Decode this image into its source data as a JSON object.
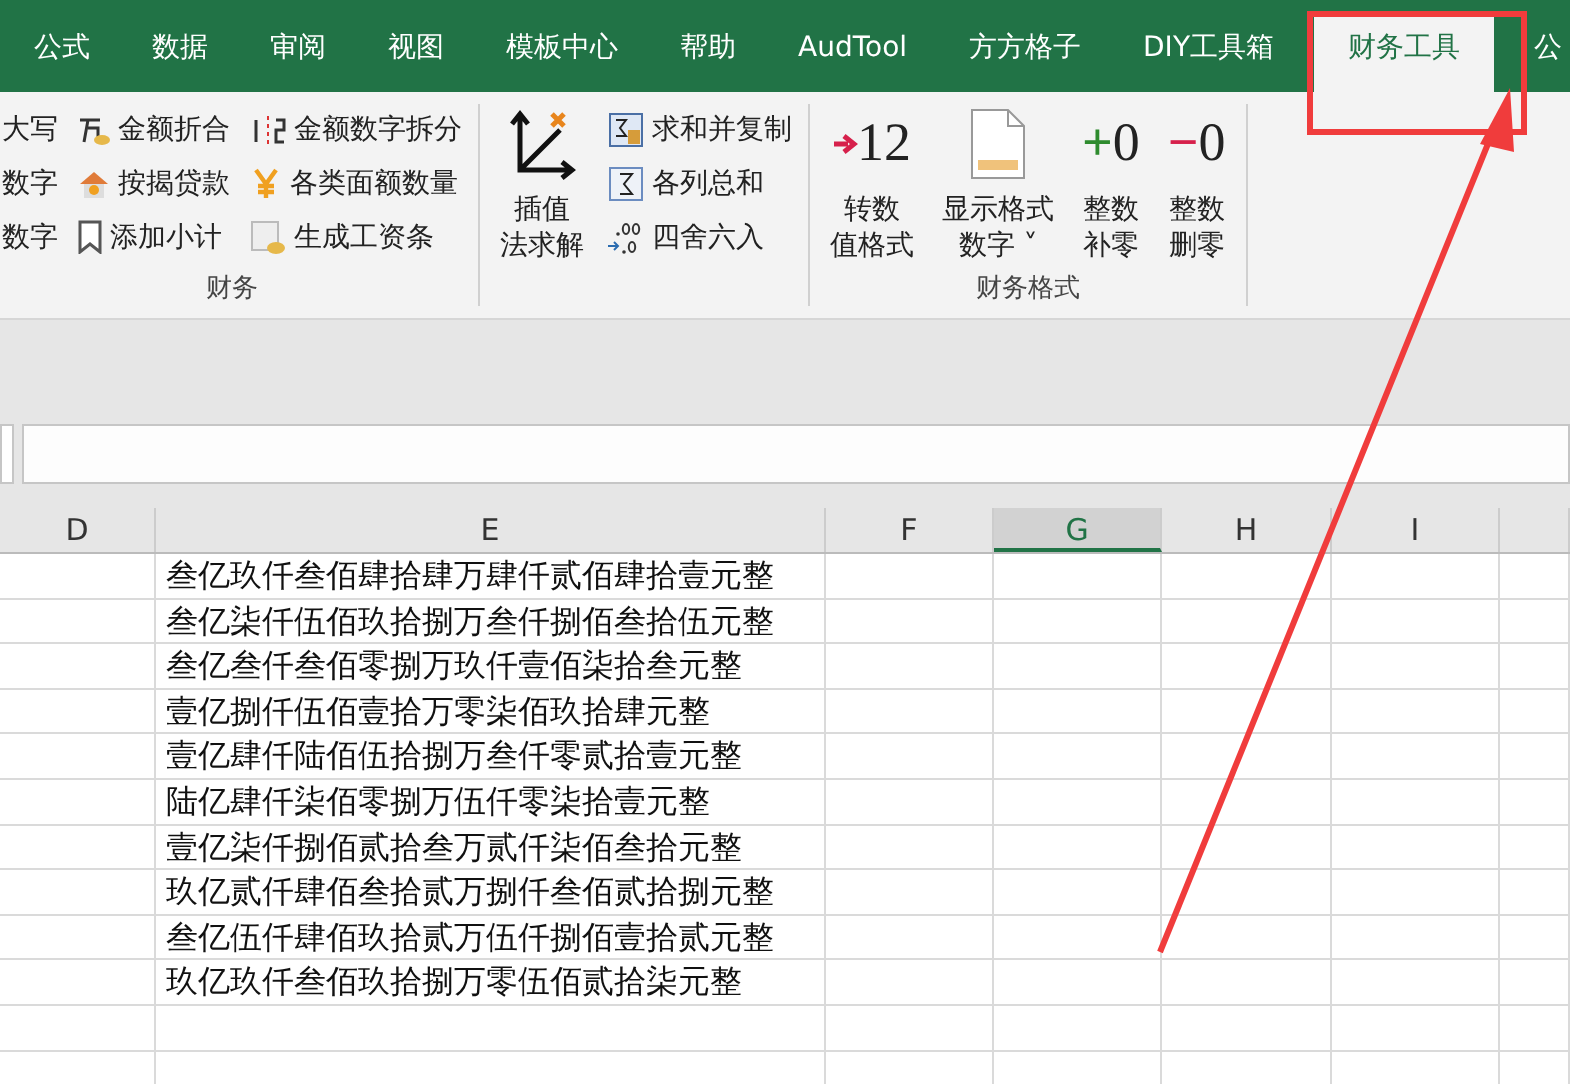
{
  "tabs": [
    {
      "label": "公式",
      "selected": false
    },
    {
      "label": "数据",
      "selected": false
    },
    {
      "label": "审阅",
      "selected": false
    },
    {
      "label": "视图",
      "selected": false
    },
    {
      "label": "模板中心",
      "selected": false
    },
    {
      "label": "帮助",
      "selected": false
    },
    {
      "label": "AudTool",
      "selected": false
    },
    {
      "label": "方方格子",
      "selected": false
    },
    {
      "label": "DIY工具箱",
      "selected": false
    },
    {
      "label": "财务工具",
      "selected": true
    },
    {
      "label": "公",
      "selected": false
    }
  ],
  "ribbon": {
    "groups": [
      {
        "label": "财务",
        "columns": [
          {
            "items": [
              {
                "label": "大写"
              },
              {
                "label": "数字"
              },
              {
                "label": "数字"
              }
            ]
          },
          {
            "items": [
              {
                "label": "金额折合"
              },
              {
                "label": "按揭贷款"
              },
              {
                "label": "添加小计"
              }
            ]
          },
          {
            "items": [
              {
                "label": "金额数字拆分"
              },
              {
                "label": "各类面额数量"
              },
              {
                "label": "生成工资条"
              }
            ]
          }
        ]
      },
      {
        "large": [
          {
            "lines": [
              "插值",
              "法求解"
            ]
          }
        ],
        "columns": [
          {
            "items": [
              {
                "label": "求和并复制"
              },
              {
                "label": "各列总和"
              },
              {
                "label": "四舍六入"
              }
            ]
          }
        ]
      },
      {
        "label": "财务格式",
        "large": [
          {
            "lines": [
              "转数",
              "值格式"
            ],
            "digits": "12"
          },
          {
            "lines": [
              "显示格式",
              "数字 ˅"
            ]
          },
          {
            "lines": [
              "整数",
              "补零"
            ],
            "sign": "+",
            "digits": "0"
          },
          {
            "lines": [
              "整数",
              "删零"
            ],
            "sign": "−",
            "digits": "0"
          }
        ]
      }
    ]
  },
  "sheet": {
    "columns": [
      {
        "label": "D",
        "selected": false
      },
      {
        "label": "E",
        "selected": false
      },
      {
        "label": "F",
        "selected": false
      },
      {
        "label": "G",
        "selected": true
      },
      {
        "label": "H",
        "selected": false
      },
      {
        "label": "I",
        "selected": false
      }
    ],
    "rows": [
      [
        "",
        "叁亿玖仟叁佰肆拾肆万肆仟贰佰肆拾壹元整"
      ],
      [
        "",
        "叁亿柒仟伍佰玖拾捌万叁仟捌佰叁拾伍元整"
      ],
      [
        "",
        "叁亿叁仟叁佰零捌万玖仟壹佰柒拾叁元整"
      ],
      [
        "",
        "壹亿捌仟伍佰壹拾万零柒佰玖拾肆元整"
      ],
      [
        "",
        "壹亿肆仟陆佰伍拾捌万叁仟零贰拾壹元整"
      ],
      [
        "",
        "陆亿肆仟柒佰零捌万伍仟零柒拾壹元整"
      ],
      [
        "",
        "壹亿柒仟捌佰贰拾叁万贰仟柒佰叁拾元整"
      ],
      [
        "",
        "玖亿贰仟肆佰叁拾贰万捌仟叁佰贰拾捌元整"
      ],
      [
        "",
        "叁亿伍仟肆佰玖拾贰万伍仟捌佰壹拾贰元整"
      ],
      [
        "",
        "玖亿玖仟叁佰玖拾捌万零伍佰贰拾柒元整"
      ],
      [
        "",
        ""
      ],
      [
        "",
        ""
      ]
    ]
  }
}
